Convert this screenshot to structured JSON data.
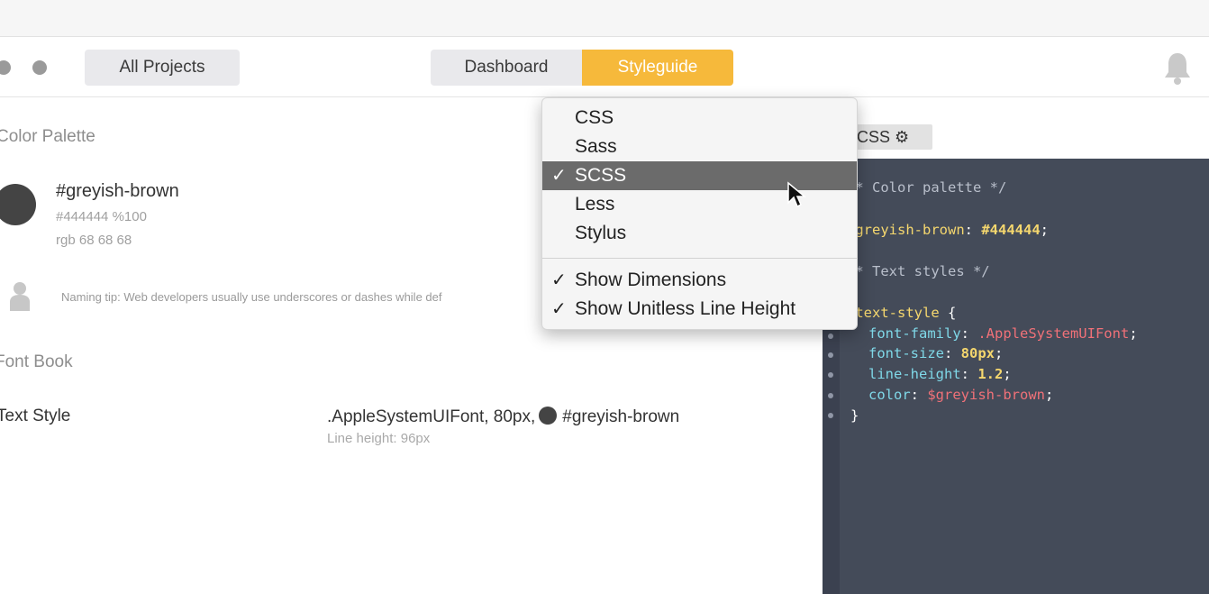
{
  "toolbar": {
    "all_projects": "All Projects",
    "tabs": [
      {
        "label": "Dashboard",
        "active": false
      },
      {
        "label": "Styleguide",
        "active": true
      }
    ]
  },
  "colors": {
    "accent": "#f6b93b",
    "swatch": "#444444",
    "code_bg": "#444b59"
  },
  "color_palette": {
    "title": "Color Palette",
    "items": [
      {
        "name": "#greyish-brown",
        "hex_opacity": "#444444  %100",
        "rgb": "rgb 68 68 68"
      }
    ],
    "tip": "Naming tip: Web developers usually use underscores or dashes while def"
  },
  "font_book": {
    "title": "Font Book",
    "styles": [
      {
        "label": "Text Style",
        "description": ".AppleSystemUIFont, 80px,",
        "color_name": "#greyish-brown",
        "line_height": "Line height: 96px"
      }
    ]
  },
  "code_panel": {
    "language_label": "CSS",
    "lines": {
      "c1": "/* Color palette */",
      "v1_name": "$greyish-brown",
      "v1_val": "#444444",
      "c2": "/* Text styles */",
      "sel": "@text-style",
      "p1": "font-family",
      "p1v": ".AppleSystemUIFont",
      "p2": "font-size",
      "p2v": "80px",
      "p3": "line-height",
      "p3v": "1.2",
      "p4": "color",
      "p4v": "$greyish-brown"
    }
  },
  "menu": {
    "items": [
      {
        "label": "CSS",
        "checked": false
      },
      {
        "label": "Sass",
        "checked": false
      },
      {
        "label": "SCSS",
        "checked": true
      },
      {
        "label": "Less",
        "checked": false
      },
      {
        "label": "Stylus",
        "checked": false
      }
    ],
    "options": [
      {
        "label": "Show Dimensions",
        "checked": true
      },
      {
        "label": "Show Unitless Line Height",
        "checked": true
      }
    ],
    "check_glyph": "✓"
  }
}
